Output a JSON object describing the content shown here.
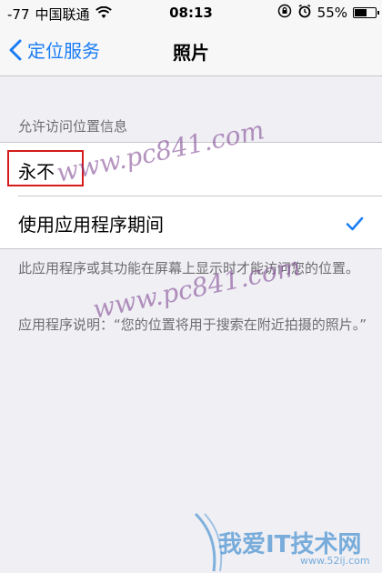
{
  "status_bar": {
    "signal": "-77",
    "carrier": "中国联通",
    "wifi_icon": "wifi-icon",
    "time": "08:13",
    "rotation_lock_icon": "rotation-lock-icon",
    "alarm_icon": "alarm-icon",
    "battery_percent": "55%",
    "battery_level": 0.55
  },
  "nav": {
    "back_label": "定位服务",
    "back_icon": "chevron-left-icon",
    "title": "照片"
  },
  "section": {
    "header": "允许访问位置信息",
    "options": [
      {
        "label": "永不",
        "selected": false,
        "highlighted": true
      },
      {
        "label": "使用应用程序期间",
        "selected": true
      }
    ]
  },
  "footer": {
    "note": "此应用程序或其功能在屏幕上显示时才能访问您的位置。",
    "description": "应用程序说明：“您的位置将用于搜索在附近拍摄的照片。”"
  },
  "watermarks": {
    "site1": "www.pc841.com",
    "site2": "www.pc841.com",
    "logo_text": "我爱IT技术网",
    "logo_sub": "www.52ij.com"
  },
  "colors": {
    "accent": "#1a7cf4",
    "highlight_border": "#d61b1b",
    "background": "#efeff4"
  }
}
